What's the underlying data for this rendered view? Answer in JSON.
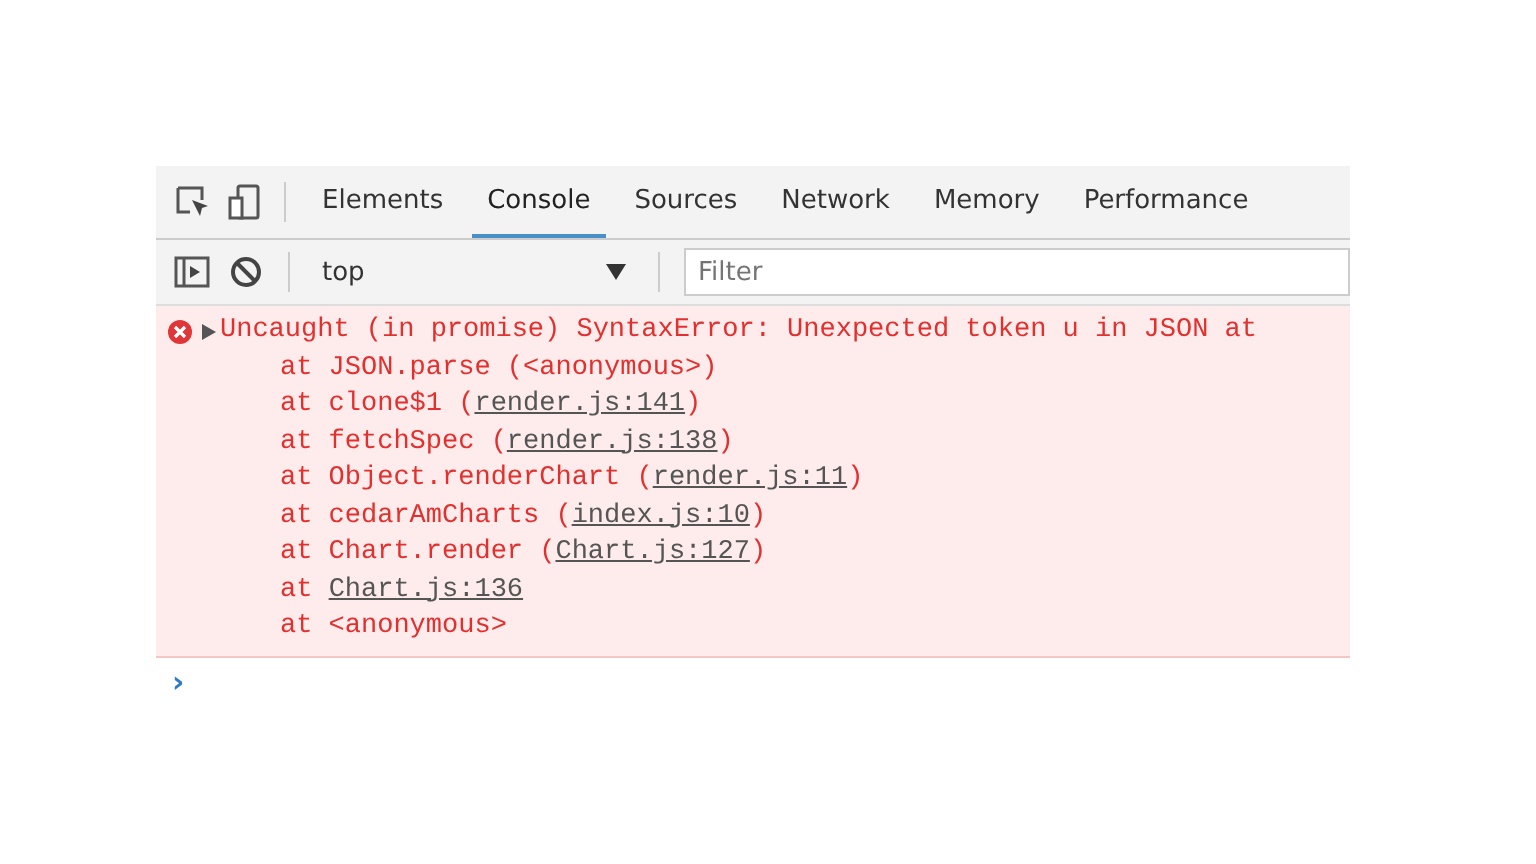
{
  "tabs": [
    {
      "label": "Elements",
      "selected": false
    },
    {
      "label": "Console",
      "selected": true
    },
    {
      "label": "Sources",
      "selected": false
    },
    {
      "label": "Network",
      "selected": false
    },
    {
      "label": "Memory",
      "selected": false
    },
    {
      "label": "Performance",
      "selected": false
    }
  ],
  "toolbar": {
    "context": "top",
    "filter": {
      "placeholder": "Filter"
    }
  },
  "error": {
    "message": "Uncaught (in promise) SyntaxError: Unexpected token u in JSON at",
    "expanded": false,
    "stack": [
      {
        "before": "at JSON.parse (<anonymous>)"
      },
      {
        "before": "at clone$1 (",
        "link": "render.js:141",
        "after": ")"
      },
      {
        "before": "at fetchSpec (",
        "link": "render.js:138",
        "after": ")"
      },
      {
        "before": "at Object.renderChart (",
        "link": "render.js:11",
        "after": ")"
      },
      {
        "before": "at cedarAmCharts (",
        "link": "index.js:10",
        "after": ")"
      },
      {
        "before": "at Chart.render (",
        "link": "Chart.js:127",
        "after": ")"
      },
      {
        "before": "at ",
        "link": "Chart.js:136"
      },
      {
        "before": "at <anonymous>"
      }
    ]
  },
  "prompt": "›"
}
